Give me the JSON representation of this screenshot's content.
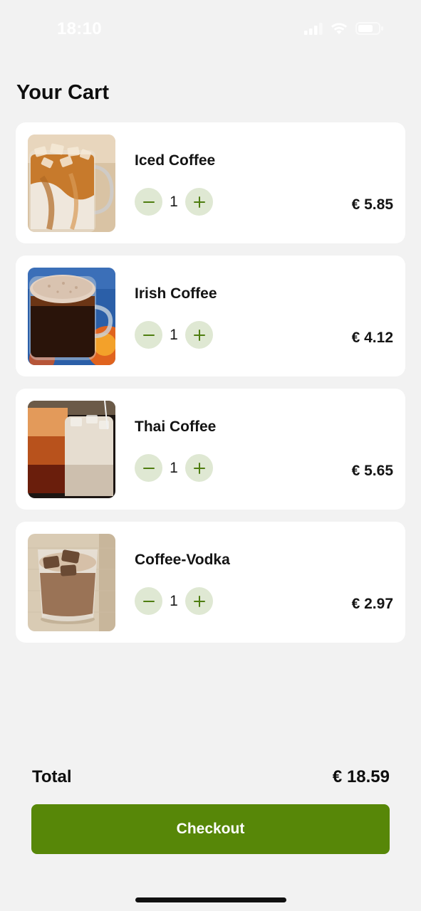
{
  "status_bar": {
    "time": "18:10",
    "icons": [
      "cellular-signal-icon",
      "wifi-icon",
      "battery-icon"
    ]
  },
  "page": {
    "title": "Your Cart"
  },
  "cart": {
    "items": [
      {
        "name": "Iced Coffee",
        "quantity": "1",
        "price": "€ 5.85",
        "image": "iced-coffee-image"
      },
      {
        "name": "Irish Coffee",
        "quantity": "1",
        "price": "€ 4.12",
        "image": "irish-coffee-image"
      },
      {
        "name": "Thai Coffee",
        "quantity": "1",
        "price": "€ 5.65",
        "image": "thai-coffee-image"
      },
      {
        "name": "Coffee-Vodka",
        "quantity": "1",
        "price": "€ 2.97",
        "image": "coffee-vodka-image"
      }
    ],
    "decrement_icon": "minus-icon",
    "increment_icon": "plus-icon"
  },
  "summary": {
    "total_label": "Total",
    "total_value": "€ 18.59"
  },
  "checkout": {
    "label": "Checkout"
  },
  "colors": {
    "background": "#f2f2f2",
    "card": "#ffffff",
    "accent": "#578708",
    "qty_button_bg": "#dfe8d3",
    "qty_icon": "#4e7d10"
  }
}
